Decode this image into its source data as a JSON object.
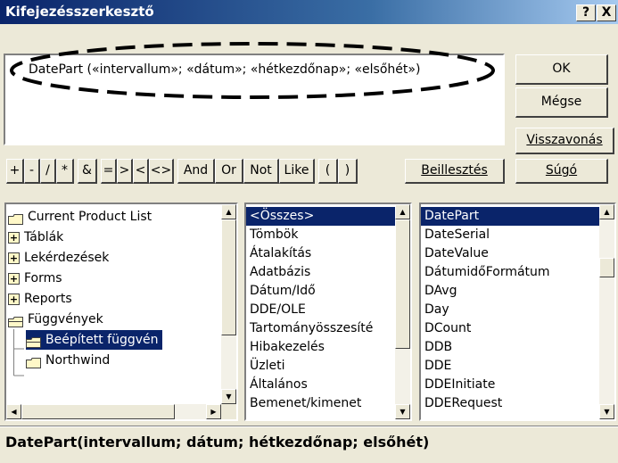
{
  "window": {
    "title": "Kifejezésszerkesztő",
    "help_btn": "?",
    "close_btn": "X"
  },
  "expression": {
    "text": "DatePart («intervallum»; «dátum»; «hétkezdőnap»; «elsőhét»)"
  },
  "buttons": {
    "ok": "OK",
    "cancel": "Mégse",
    "undo": "Visszavonás",
    "paste": "Beillesztés",
    "help": "Súgó"
  },
  "operators": {
    "arith": [
      "+",
      "-",
      "/",
      "*"
    ],
    "concat": [
      "&"
    ],
    "compare": [
      "=",
      ">",
      "<",
      "<>"
    ],
    "logic": [
      "And",
      "Or",
      "Not",
      "Like"
    ],
    "paren": [
      "(",
      ")"
    ]
  },
  "tree": {
    "items": [
      "Current Product List",
      "Táblák",
      "Lekérdezések",
      "Forms",
      "Reports",
      "Függvények",
      "Beépített függvén",
      "Northwind"
    ]
  },
  "categories": {
    "items": [
      "<Összes>",
      "Tömbök",
      "Átalakítás",
      "Adatbázis",
      "Dátum/Idő",
      "DDE/OLE",
      "Tartományösszesíté",
      "Hibakezelés",
      "Üzleti",
      "Általános",
      "Bemenet/kimenet"
    ]
  },
  "functions": {
    "items": [
      "DatePart",
      "DateSerial",
      "DateValue",
      "DátumidőFormátum",
      "DAvg",
      "Day",
      "DCount",
      "DDB",
      "DDE",
      "DDEInitiate",
      "DDERequest"
    ]
  },
  "status": {
    "text": "DatePart(intervallum; dátum; hétkezdőnap; elsőhét)"
  },
  "colors": {
    "selection": "#0a246a",
    "annotation": "#000000"
  }
}
